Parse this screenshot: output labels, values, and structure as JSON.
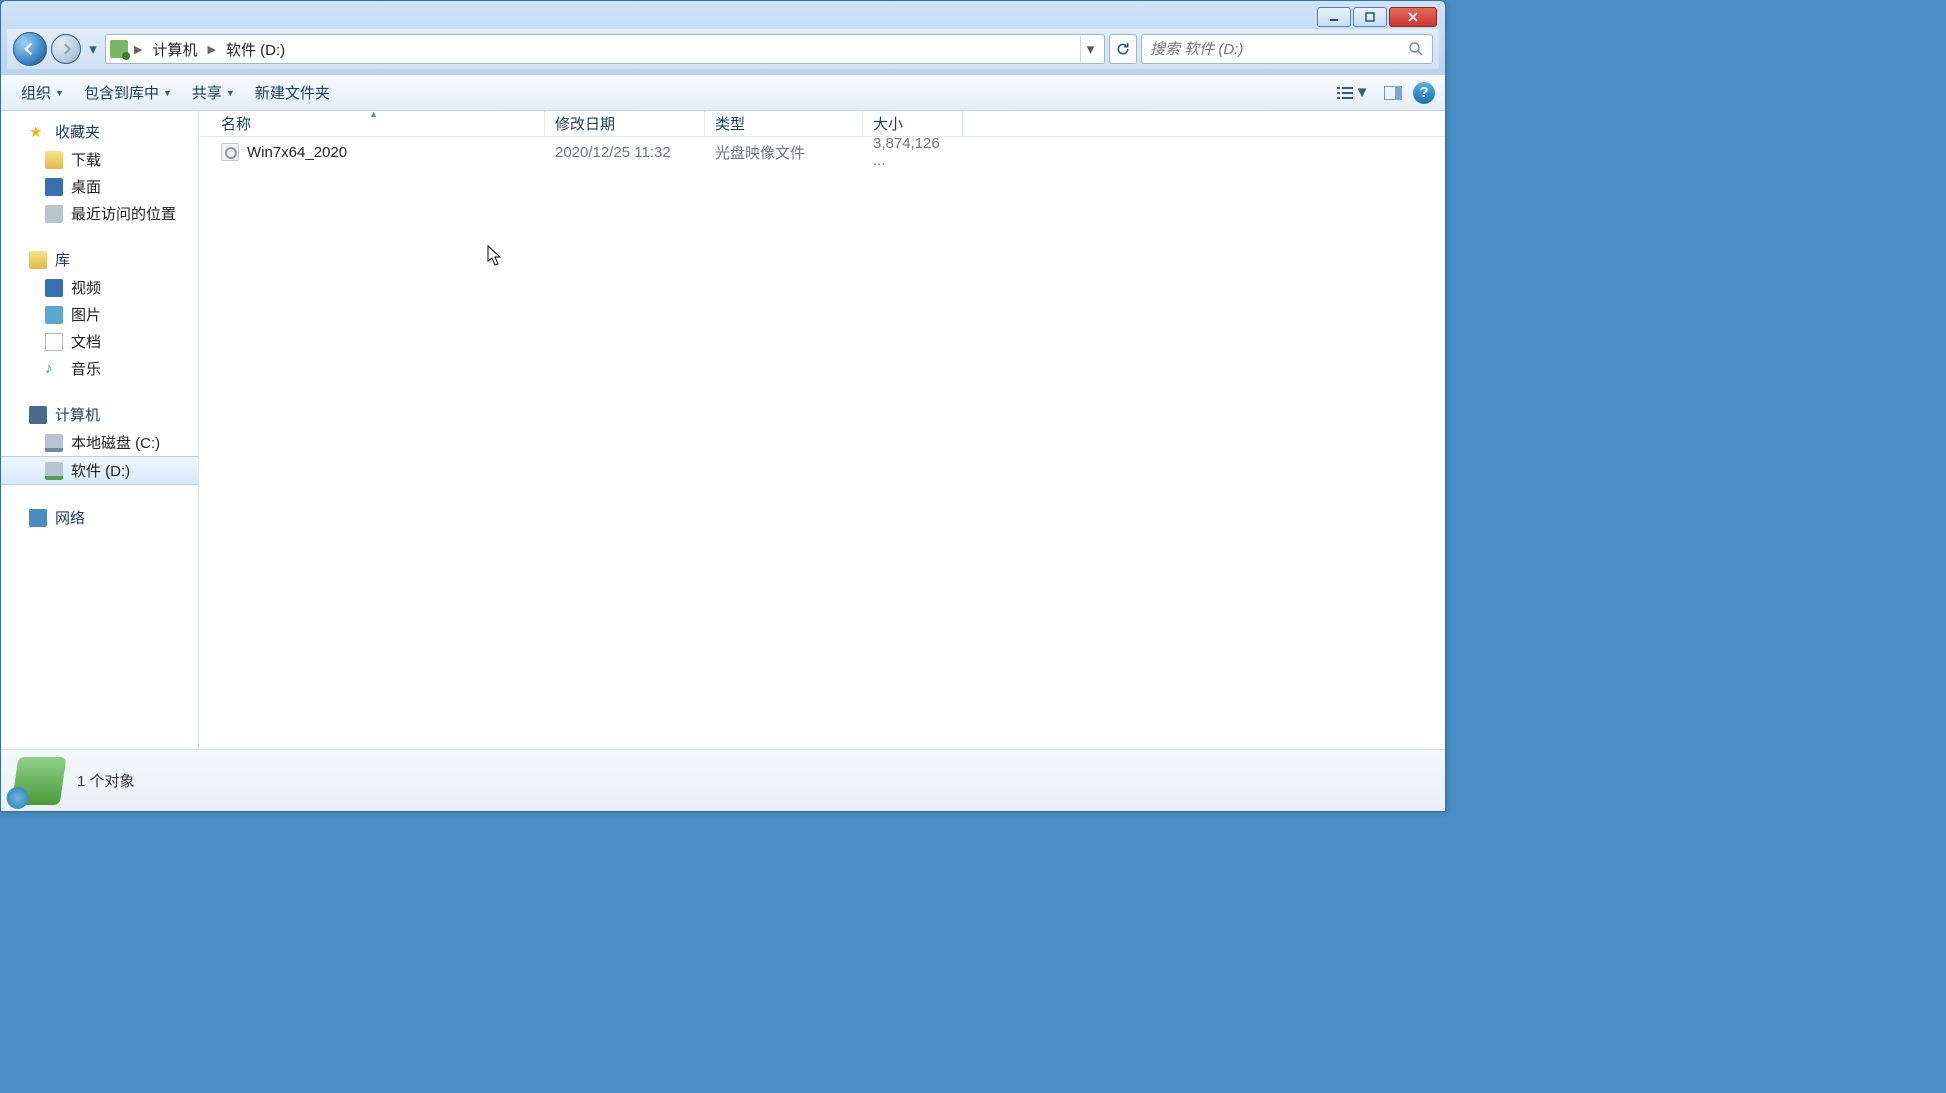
{
  "address": {
    "parts": [
      "计算机",
      "软件 (D:)"
    ]
  },
  "search": {
    "placeholder": "搜索 软件 (D:)"
  },
  "toolbar": {
    "organize": "组织",
    "include": "包含到库中",
    "share": "共享",
    "newfolder": "新建文件夹"
  },
  "sidebar": {
    "favorites": {
      "label": "收藏夹",
      "items": [
        "下载",
        "桌面",
        "最近访问的位置"
      ]
    },
    "libraries": {
      "label": "库",
      "items": [
        "视频",
        "图片",
        "文档",
        "音乐"
      ]
    },
    "computer": {
      "label": "计算机",
      "items": [
        "本地磁盘 (C:)",
        "软件 (D:)"
      ]
    },
    "network": {
      "label": "网络"
    }
  },
  "columns": {
    "name": "名称",
    "date": "修改日期",
    "type": "类型",
    "size": "大小"
  },
  "files": [
    {
      "name": "Win7x64_2020",
      "date": "2020/12/25 11:32",
      "type": "光盘映像文件",
      "size": "3,874,126 ..."
    }
  ],
  "status": {
    "text": "1 个对象"
  }
}
